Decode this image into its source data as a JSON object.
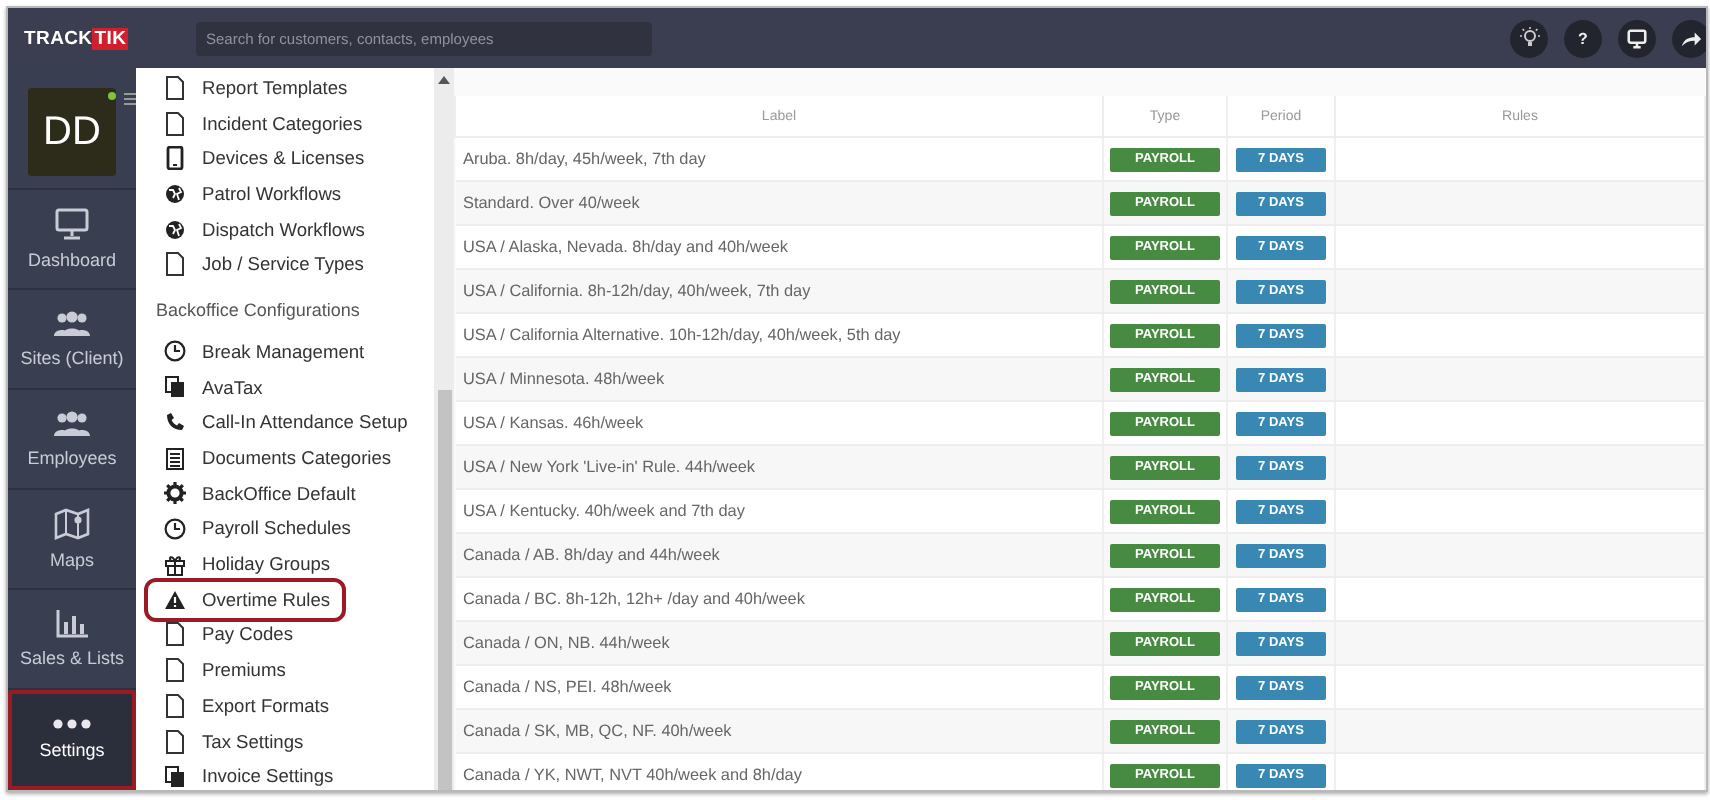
{
  "top_bar": {
    "logo": {
      "part_1": "TRACK",
      "part_2": "TIK"
    },
    "search": {
      "placeholder": "Search for customers, contacts, employees"
    },
    "help_label": "?"
  },
  "user": {
    "initials": "DD",
    "online": true
  },
  "nav": [
    {
      "label": "Dashboard",
      "kind": "monitor",
      "highlighted": false
    },
    {
      "label": "Sites (Client)",
      "kind": "people",
      "highlighted": false
    },
    {
      "label": "Employees",
      "kind": "people",
      "highlighted": false
    },
    {
      "label": "Maps",
      "kind": "map",
      "highlighted": false
    },
    {
      "label": "Sales & Lists",
      "kind": "chart",
      "highlighted": false
    },
    {
      "label": "Settings",
      "kind": "dots",
      "highlighted": true
    }
  ],
  "menu": {
    "top_items": [
      {
        "label": "Report Templates",
        "kind": "page",
        "highlighted": false
      },
      {
        "label": "Incident Categories",
        "kind": "page",
        "highlighted": false
      },
      {
        "label": "Devices & Licenses",
        "kind": "tablet",
        "highlighted": false
      },
      {
        "label": "Patrol Workflows",
        "kind": "globe",
        "highlighted": false
      },
      {
        "label": "Dispatch Workflows",
        "kind": "globe",
        "highlighted": false
      },
      {
        "label": "Job / Service Types",
        "kind": "page",
        "highlighted": false
      }
    ],
    "section_title": "Backoffice Configurations",
    "section_items": [
      {
        "label": "Break Management",
        "kind": "clock",
        "highlighted": false
      },
      {
        "label": "AvaTax",
        "kind": "copy",
        "highlighted": false
      },
      {
        "label": "Call-In Attendance Setup",
        "kind": "phone",
        "highlighted": false
      },
      {
        "label": "Documents Categories",
        "kind": "list",
        "highlighted": false
      },
      {
        "label": "BackOffice Default",
        "kind": "gear",
        "highlighted": false
      },
      {
        "label": "Payroll Schedules",
        "kind": "clock",
        "highlighted": false
      },
      {
        "label": "Holiday Groups",
        "kind": "gift",
        "highlighted": false
      },
      {
        "label": "Overtime Rules",
        "kind": "warning",
        "highlighted": true
      },
      {
        "label": "Pay Codes",
        "kind": "page",
        "highlighted": false
      },
      {
        "label": "Premiums",
        "kind": "page",
        "highlighted": false
      },
      {
        "label": "Export Formats",
        "kind": "page",
        "highlighted": false
      },
      {
        "label": "Tax Settings",
        "kind": "page",
        "highlighted": false
      },
      {
        "label": "Invoice Settings",
        "kind": "copy",
        "highlighted": false
      }
    ]
  },
  "table": {
    "columns": [
      "Label",
      "Type",
      "Period",
      "Rules"
    ],
    "rows": [
      {
        "label": "Aruba. 8h/day, 45h/week, 7th day",
        "type": "PAYROLL",
        "period": "7 DAYS"
      },
      {
        "label": "Standard. Over 40/week",
        "type": "PAYROLL",
        "period": "7 DAYS"
      },
      {
        "label": "USA / Alaska, Nevada. 8h/day and 40h/week",
        "type": "PAYROLL",
        "period": "7 DAYS"
      },
      {
        "label": "USA / California. 8h-12h/day, 40h/week, 7th day",
        "type": "PAYROLL",
        "period": "7 DAYS"
      },
      {
        "label": "USA / California Alternative. 10h-12h/day, 40h/week, 5th day",
        "type": "PAYROLL",
        "period": "7 DAYS"
      },
      {
        "label": "USA / Minnesota. 48h/week",
        "type": "PAYROLL",
        "period": "7 DAYS"
      },
      {
        "label": "USA / Kansas. 46h/week",
        "type": "PAYROLL",
        "period": "7 DAYS"
      },
      {
        "label": "USA / New York 'Live-in' Rule. 44h/week",
        "type": "PAYROLL",
        "period": "7 DAYS"
      },
      {
        "label": "USA / Kentucky. 40h/week and 7th day",
        "type": "PAYROLL",
        "period": "7 DAYS"
      },
      {
        "label": "Canada / AB. 8h/day and 44h/week",
        "type": "PAYROLL",
        "period": "7 DAYS"
      },
      {
        "label": "Canada / BC. 8h-12h, 12h+ /day and 40h/week",
        "type": "PAYROLL",
        "period": "7 DAYS"
      },
      {
        "label": "Canada / ON, NB. 44h/week",
        "type": "PAYROLL",
        "period": "7 DAYS"
      },
      {
        "label": "Canada / NS, PEI. 48h/week",
        "type": "PAYROLL",
        "period": "7 DAYS"
      },
      {
        "label": "Canada / SK, MB, QC, NF. 40h/week",
        "type": "PAYROLL",
        "period": "7 DAYS"
      },
      {
        "label": "Canada / YK, NWT, NVT 40h/week and 8h/day",
        "type": "PAYROLL",
        "period": "7 DAYS"
      }
    ]
  }
}
